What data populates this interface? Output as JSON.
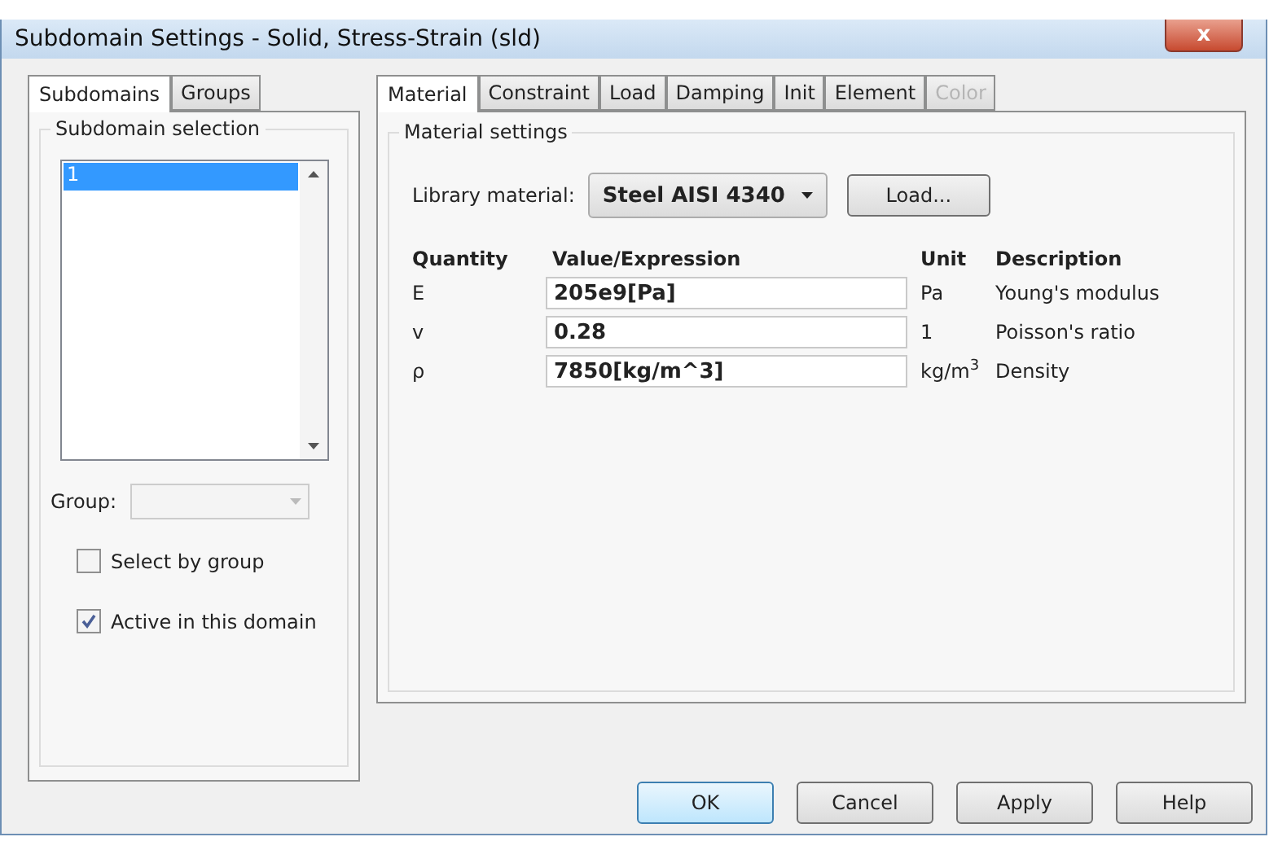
{
  "window": {
    "title": "Subdomain Settings - Solid, Stress-Strain (sld)",
    "close": "x"
  },
  "left_tabs": [
    {
      "label": "Subdomains",
      "selected": true
    },
    {
      "label": "Groups",
      "selected": false
    }
  ],
  "subdomain_selection": {
    "title": "Subdomain selection",
    "items": [
      {
        "label": "1",
        "selected": true
      }
    ]
  },
  "group": {
    "label": "Group:"
  },
  "checkboxes": [
    {
      "label": "Select by group",
      "checked": false
    },
    {
      "label": "Active in this domain",
      "checked": true
    }
  ],
  "right_tabs": [
    {
      "label": "Material",
      "selected": true,
      "disabled": false
    },
    {
      "label": "Constraint",
      "selected": false,
      "disabled": false
    },
    {
      "label": "Load",
      "selected": false,
      "disabled": false
    },
    {
      "label": "Damping",
      "selected": false,
      "disabled": false
    },
    {
      "label": "Init",
      "selected": false,
      "disabled": false
    },
    {
      "label": "Element",
      "selected": false,
      "disabled": false
    },
    {
      "label": "Color",
      "selected": false,
      "disabled": true
    }
  ],
  "material_settings": {
    "title": "Material settings",
    "library_label": "Library material:",
    "library_value": "Steel AISI 4340",
    "load_button": "Load...",
    "columns": [
      "Quantity",
      "Value/Expression",
      "Unit",
      "Description"
    ],
    "rows": [
      {
        "quantity": "E",
        "value": "205e9[Pa]",
        "unit": "Pa",
        "description": "Young's modulus"
      },
      {
        "quantity": "v",
        "value": "0.28",
        "unit": "1",
        "description": "Poisson's ratio"
      },
      {
        "quantity": "ρ",
        "value": "7850[kg/m^3]",
        "unit": "kg/m$^{3}$",
        "description": "Density"
      }
    ]
  },
  "buttons": [
    {
      "label": "OK",
      "default": true
    },
    {
      "label": "Cancel",
      "default": false
    },
    {
      "label": "Apply",
      "default": false
    },
    {
      "label": "Help",
      "default": false
    }
  ]
}
